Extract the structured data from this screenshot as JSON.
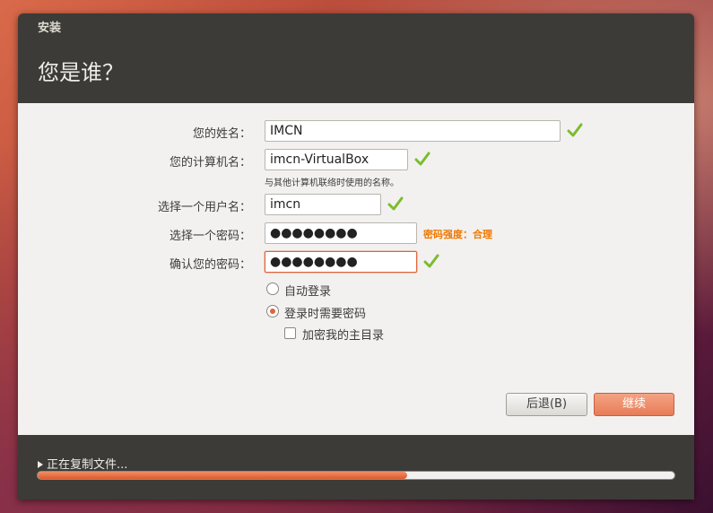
{
  "window": {
    "title": "安装",
    "heading": "您是谁？"
  },
  "form": {
    "name_label": "您的姓名：",
    "name_value": "IMCN",
    "computer_label": "您的计算机名：",
    "computer_value": "imcn-VirtualBox",
    "computer_hint": "与其他计算机联络时使用的名称。",
    "username_label": "选择一个用户名：",
    "username_value": "imcn",
    "password_label": "选择一个密码：",
    "password_value": "●●●●●●●●",
    "password_strength": "密码强度：合理",
    "confirm_label": "确认您的密码：",
    "confirm_value": "●●●●●●●●"
  },
  "options": {
    "auto_login_label": "自动登录",
    "auto_login_selected": false,
    "require_password_label": "登录时需要密码",
    "require_password_selected": true,
    "encrypt_home_label": "加密我的主目录",
    "encrypt_home_checked": false
  },
  "buttons": {
    "back_label": "后退(B)",
    "continue_label": "继续"
  },
  "progress": {
    "label": "正在复制文件...",
    "fraction": 0.58
  },
  "colors": {
    "accent": "#e0643a",
    "valid_check": "#7cbc2d",
    "strength_text": "#f07800"
  },
  "icons": {
    "valid": "check-icon"
  }
}
